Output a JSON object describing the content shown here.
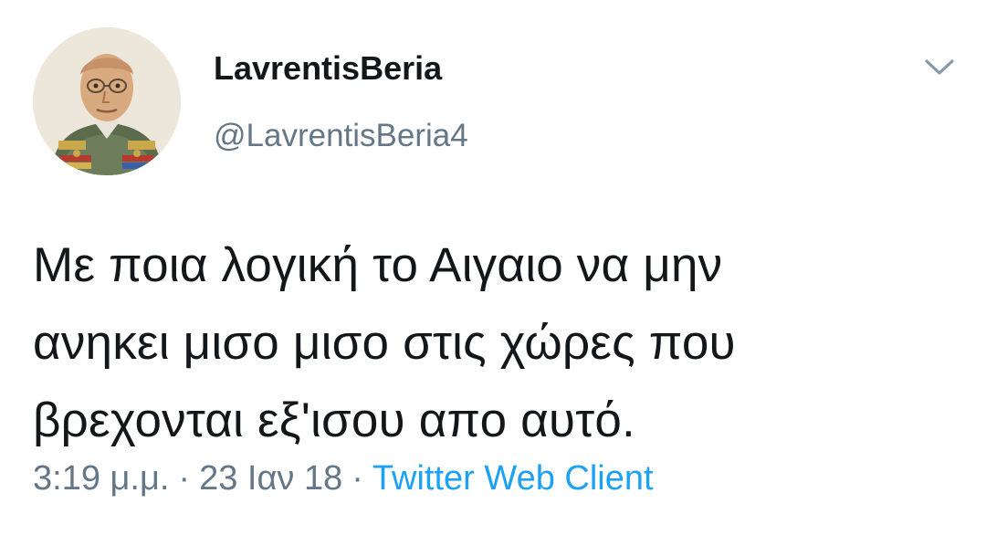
{
  "tweet": {
    "display_name": "LavrentisBeria",
    "handle": "@LavrentisBeria4",
    "text_lines": [
      "Με ποια λογική το Αιγαιο να μην",
      "ανηκει μισο μισο στις χώρες που",
      "βρεχονται εξ'ισου απο αυτό."
    ],
    "time": "3:19 μ.μ.",
    "separator": "·",
    "date": "23 Ιαν 18",
    "source": "Twitter Web Client"
  },
  "icons": {
    "avatar": "profile-photo-icon",
    "menu": "chevron-down-icon"
  },
  "colors": {
    "text": "#14171a",
    "secondary": "#657786",
    "link": "#1da1f2",
    "background": "#ffffff"
  }
}
